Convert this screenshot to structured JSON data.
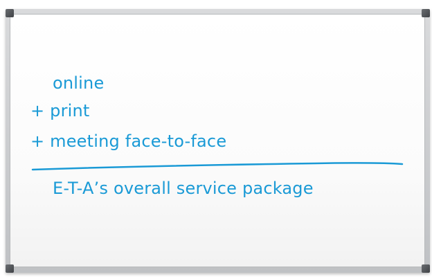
{
  "whiteboard": {
    "lines": [
      "online",
      "+ print",
      "+ meeting face-to-face"
    ],
    "summary": "E-T-A’s overall service package",
    "ink_color": "#1a9ad6"
  }
}
